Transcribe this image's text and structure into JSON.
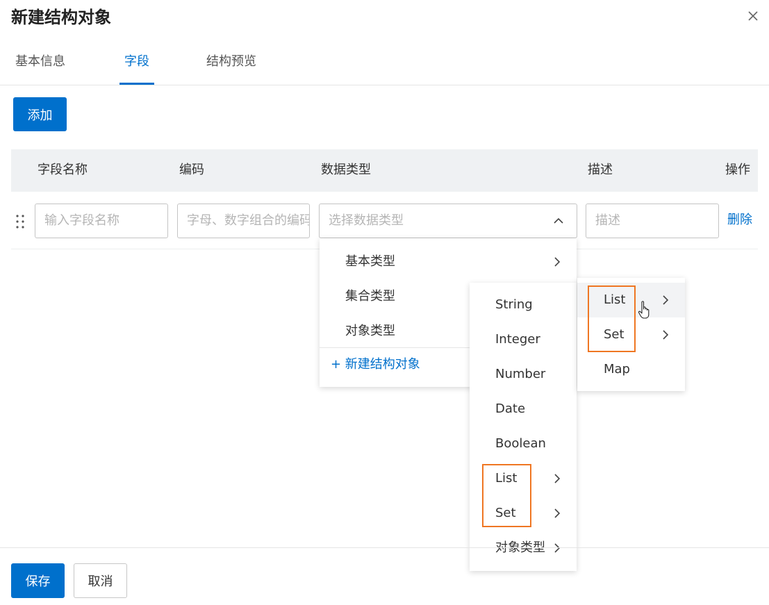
{
  "dialog": {
    "title": "新建结构对象",
    "close_icon": "close-icon"
  },
  "tabs": [
    {
      "label": "基本信息",
      "active": false
    },
    {
      "label": "字段",
      "active": true
    },
    {
      "label": "结构预览",
      "active": false
    }
  ],
  "toolbar": {
    "add_label": "添加"
  },
  "table": {
    "columns": [
      "字段名称",
      "编码",
      "数据类型",
      "描述",
      "操作"
    ],
    "row": {
      "name_placeholder": "输入字段名称",
      "code_placeholder": "字母、数字组合的编码",
      "type_placeholder": "选择数据类型",
      "desc_placeholder": "描述",
      "delete_label": "删除"
    }
  },
  "type_menu": {
    "items": [
      "基本类型",
      "集合类型",
      "对象类型"
    ],
    "create_label": "+ 新建结构对象"
  },
  "basic_type_menu": {
    "items": [
      "String",
      "Integer",
      "Number",
      "Date",
      "Boolean",
      "List",
      "Set",
      "对象类型"
    ]
  },
  "collection_menu": {
    "items": [
      "List",
      "Set",
      "Map"
    ],
    "hovered": "List"
  },
  "footer": {
    "save_label": "保存",
    "cancel_label": "取消"
  },
  "colors": {
    "accent": "#0070cc",
    "highlight": "#ef7622",
    "header_bg": "#eff1f3"
  }
}
